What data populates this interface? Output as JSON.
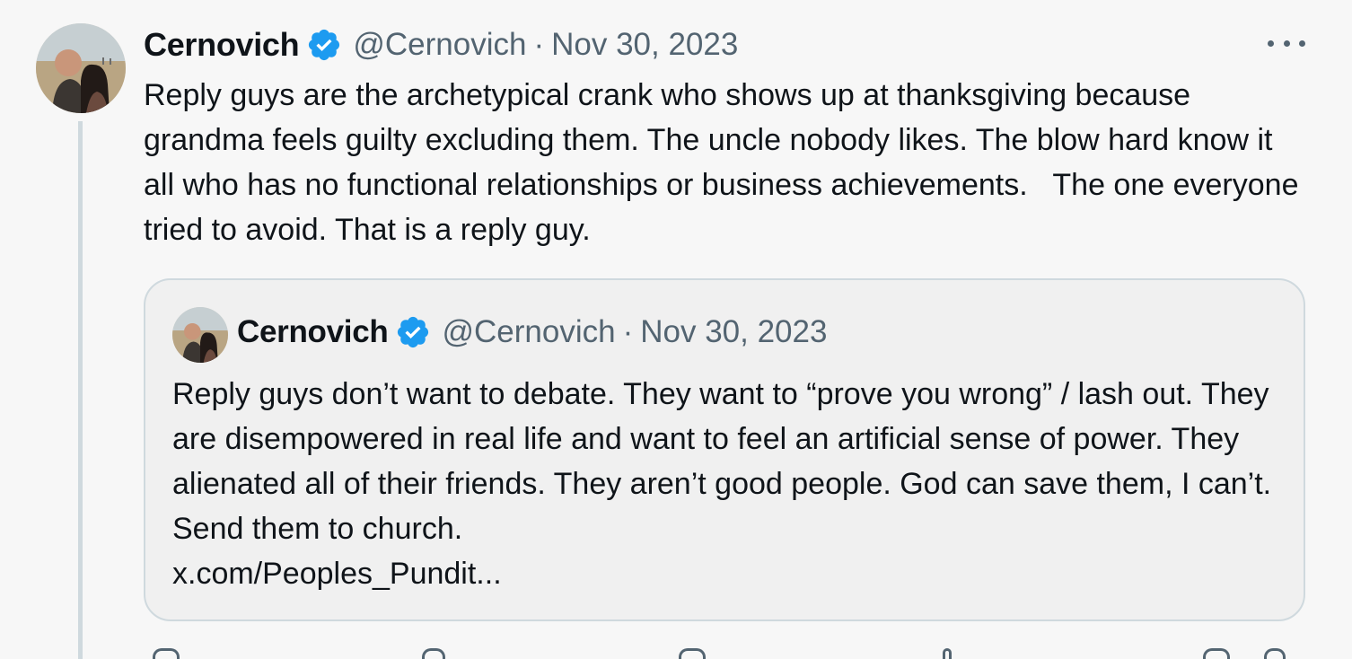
{
  "tweet": {
    "author": {
      "name": "Cernovich",
      "handle": "@Cernovich",
      "verified": true,
      "avatar": "profile-photo"
    },
    "separator": "·",
    "date": "Nov 30, 2023",
    "more_icon": "more-horizontal-icon",
    "text": "Reply guys are the archetypical crank who shows up at thanksgiving because grandma feels guilty excluding them. The uncle nobody likes. The blow hard know it all who has no functional relationships or business achievements.   The one everyone tried to avoid. That is a reply guy."
  },
  "quote": {
    "author": {
      "name": "Cernovich",
      "handle": "@Cernovich",
      "verified": true,
      "avatar": "profile-photo"
    },
    "separator": "·",
    "date": "Nov 30, 2023",
    "text": "Reply guys don’t want to debate. They want to “prove you wrong” / lash out. They are disempowered in real life and want to feel an artificial sense of power. They alienated all of their friends. They aren’t good people. God can save them, I can’t. Send them to church.",
    "link": "x.com/Peoples_Pundit..."
  },
  "actions": [
    "reply-icon",
    "repost-icon",
    "like-icon",
    "views-icon",
    "bookmark-icon",
    "share-icon"
  ],
  "colors": {
    "background": "#f7f7f7",
    "text": "#0f1419",
    "secondary_text": "#536471",
    "verified_badge": "#1d9bf0",
    "border": "#cfd9de"
  }
}
